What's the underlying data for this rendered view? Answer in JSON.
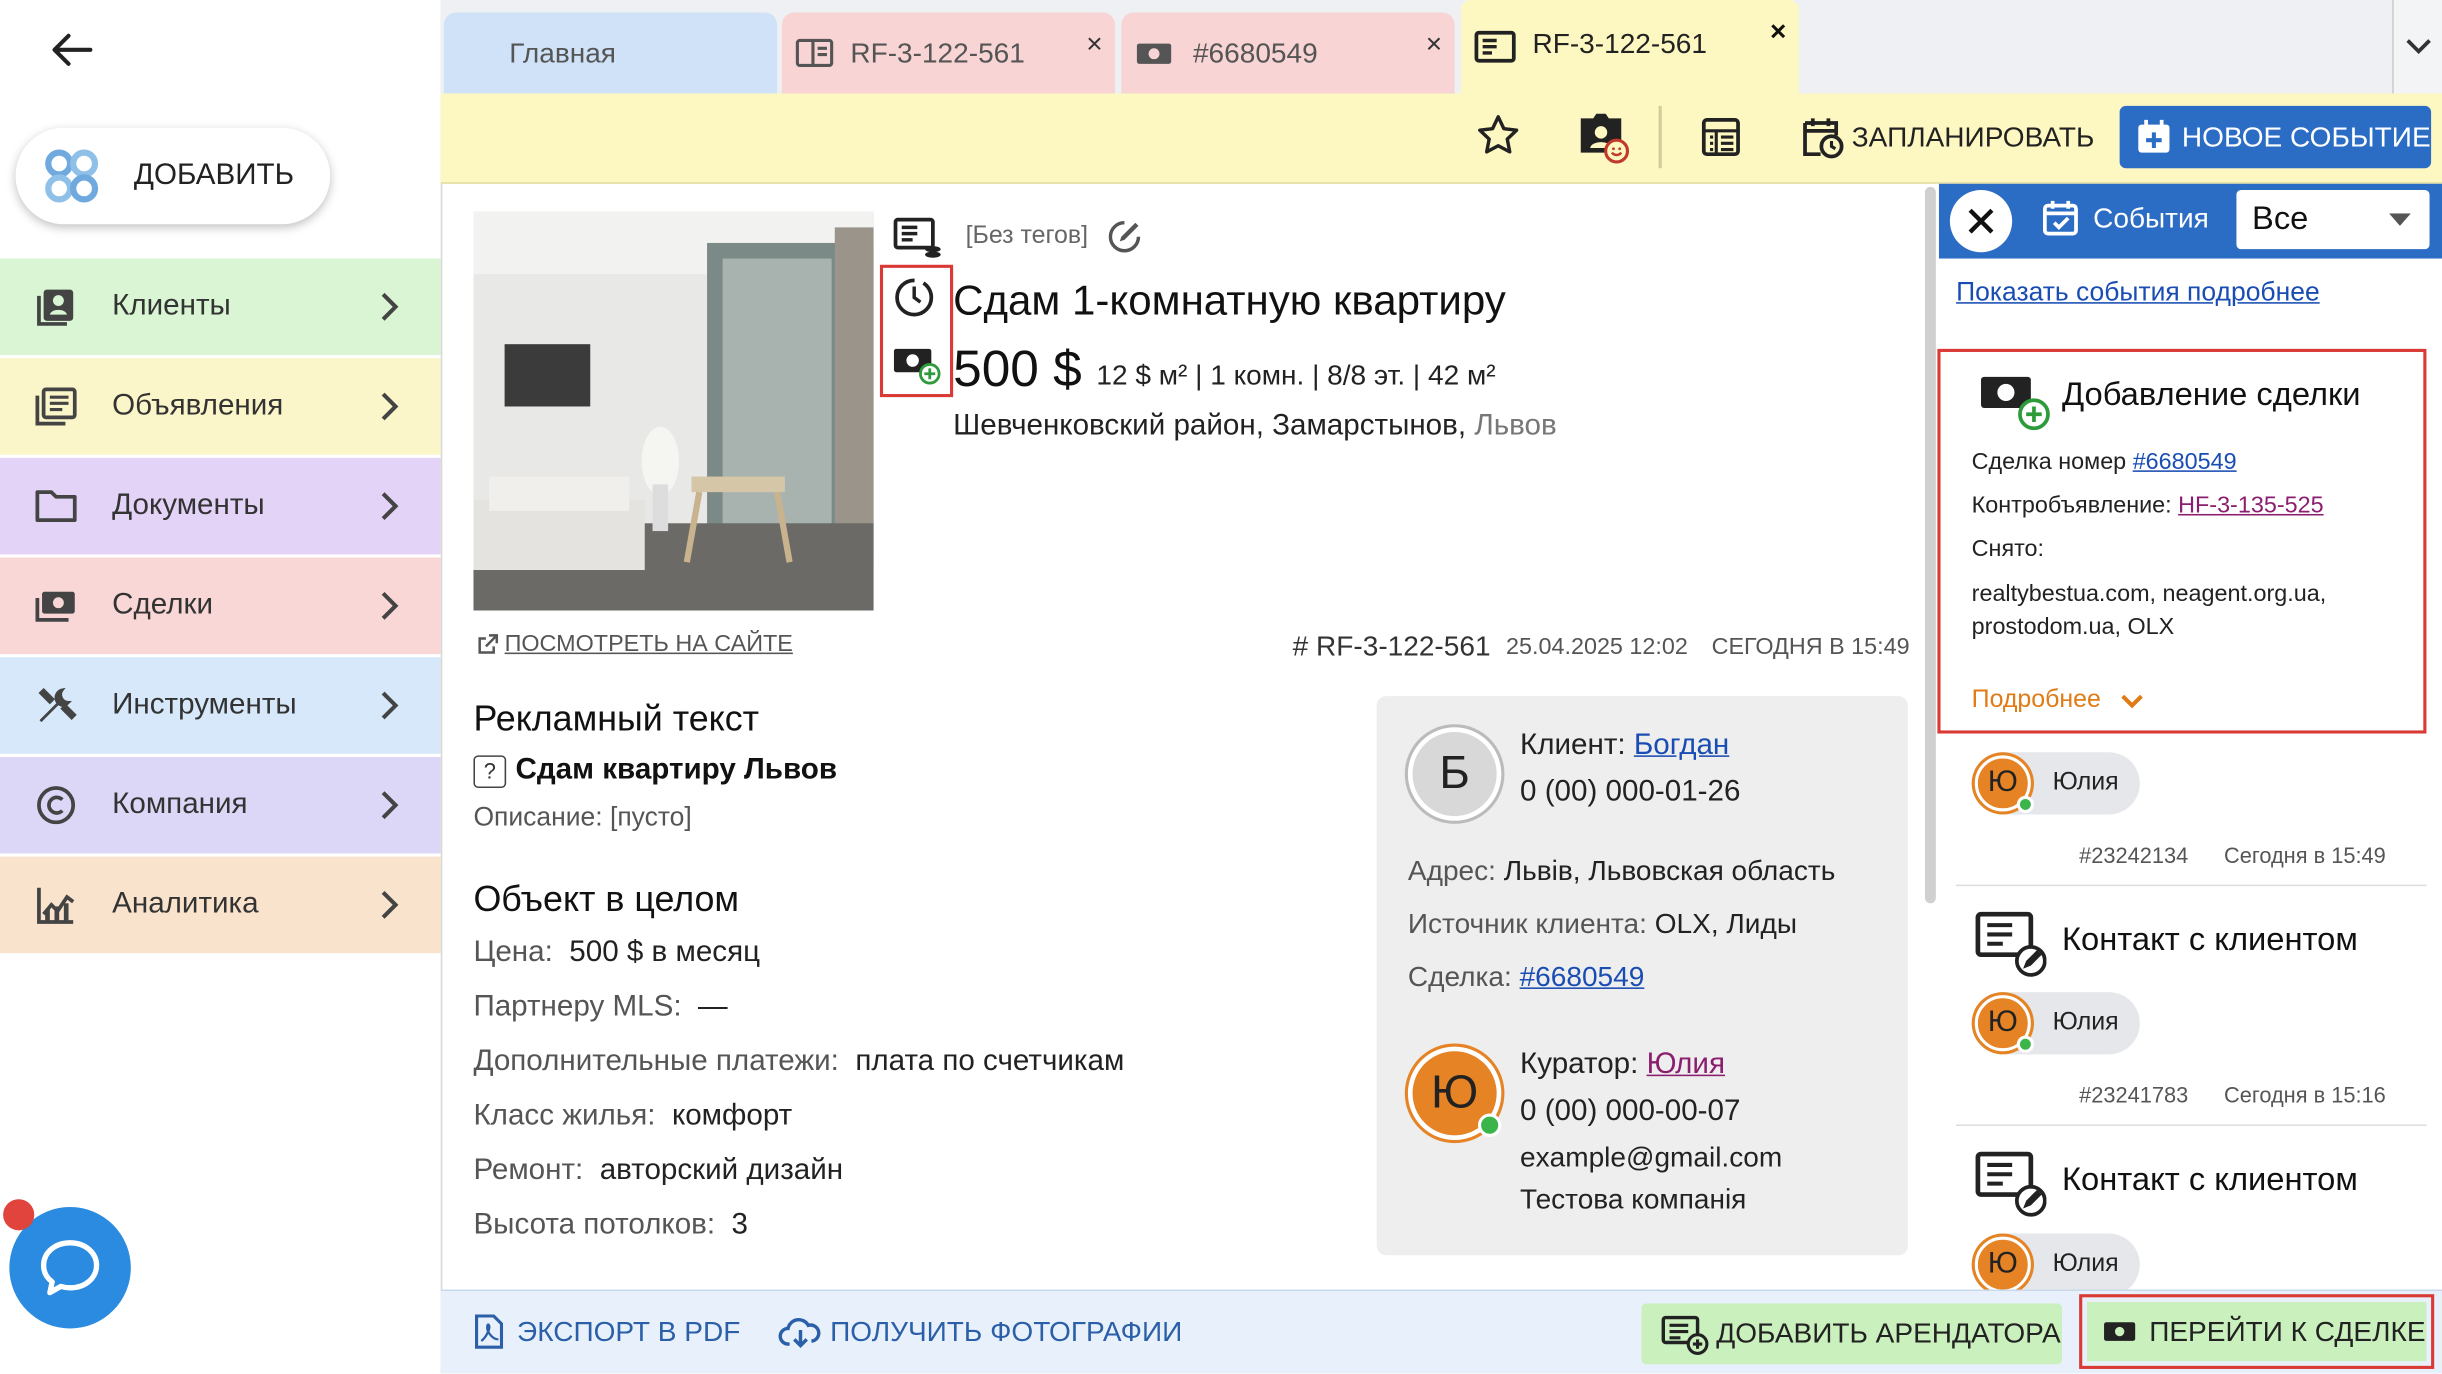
{
  "sidebar": {
    "add_label": "ДОБАВИТЬ",
    "items": [
      {
        "label": "Клиенты",
        "color": "#d9f5d3"
      },
      {
        "label": "Объявления",
        "color": "#fbf6c9"
      },
      {
        "label": "Документы",
        "color": "#e3d3f7"
      },
      {
        "label": "Сделки",
        "color": "#f8d7d6"
      },
      {
        "label": "Инструменты",
        "color": "#d6e8fa"
      },
      {
        "label": "Компания",
        "color": "#dcd7f7"
      },
      {
        "label": "Аналитика",
        "color": "#f9e3cc"
      }
    ]
  },
  "tabs": [
    {
      "label": "Главная",
      "color": "#cfe2f7"
    },
    {
      "label": "RF-3-122-561",
      "close": "×",
      "color": "#f8d4d4"
    },
    {
      "label": "#6680549",
      "close": "×",
      "color": "#f8d4d4"
    },
    {
      "label": "RF-3-122-561",
      "close": "×",
      "color": "#fdf7c2"
    }
  ],
  "toolbar": {
    "schedule_label": "ЗАПЛАНИРОВАТЬ",
    "new_event_label": "НОВОЕ СОБЫТИЕ"
  },
  "listing": {
    "tags": "[Без тегов]",
    "title": "Сдам 1-комнатную квартиру",
    "price": "500 $",
    "specs": "12 $ м² | 1 комн. | 8/8 эт. | 42 м²",
    "address": "Шевченковский район, Замарстынов,",
    "city": "Львов",
    "view_site": "ПОСМОТРЕТЬ НА САЙТЕ",
    "id": "# RF-3-122-561",
    "created": "25.04.2025 12:02",
    "updated": "СЕГОДНЯ В 15:49"
  },
  "ad": {
    "heading": "Рекламный текст",
    "q": "?",
    "title": "Сдам квартиру Львов",
    "description": "Описание: [пусто]"
  },
  "object": {
    "heading": "Объект в целом",
    "fields": [
      {
        "label": "Цена:",
        "value": "500 $ в месяц"
      },
      {
        "label": "Партнеру MLS:",
        "value": "—"
      },
      {
        "label": "Дополнительные платежи:",
        "value": "плата по счетчикам"
      },
      {
        "label": "Класс жилья:",
        "value": "комфорт"
      },
      {
        "label": "Ремонт:",
        "value": "авторский дизайн"
      },
      {
        "label": "Высота потолков:",
        "value": "3"
      }
    ]
  },
  "client": {
    "initial": "Б",
    "label": "Клиент:",
    "name": "Богдан",
    "phone": "0 (00) 000-01-26",
    "address_label": "Адрес:",
    "address": "Львів, Львовская область",
    "source_label": "Источник клиента:",
    "source": "OLX, Лиды",
    "deal_label": "Сделка:",
    "deal": "#6680549",
    "curator_initial": "Ю",
    "curator_label": "Куратор:",
    "curator": "Юлия",
    "curator_phone": "0 (00) 000-00-07",
    "email": "example@gmail.com",
    "company": "Тестова компанія"
  },
  "events": {
    "label": "События",
    "filter": "Все",
    "show_more": "Показать события подробнее",
    "deal_event": {
      "title": "Добавление сделки",
      "deal_label": "Сделка номер",
      "deal": "#6680549",
      "counter_label": "Контробъявление:",
      "counter": "HF-3-135-525",
      "removed_label": "Снято:",
      "removed_text": "realtybestua.com, neagent.org.ua, prostodom.ua, OLX",
      "more": "Подробнее"
    },
    "user_initial": "Ю",
    "user": "Юлия",
    "item1_id": "#23242134",
    "item1_time": "Сегодня в 15:49",
    "contact_title": "Контакт с клиентом",
    "item2_id": "#23241783",
    "item2_time": "Сегодня в 15:16",
    "contact_title2": "Контакт с клиентом"
  },
  "footer": {
    "pdf": "ЭКСПОРТ В PDF",
    "photos": "ПОЛУЧИТЬ ФОТОГРАФИИ",
    "add_tenant": "ДОБАВИТЬ АРЕНДАТОРА",
    "go_deal": "ПЕРЕЙТИ К СДЕЛКЕ"
  },
  "colors": {
    "accent": "#2b6cc4",
    "highlight": "#d93a35",
    "avatar": "#e58325"
  }
}
